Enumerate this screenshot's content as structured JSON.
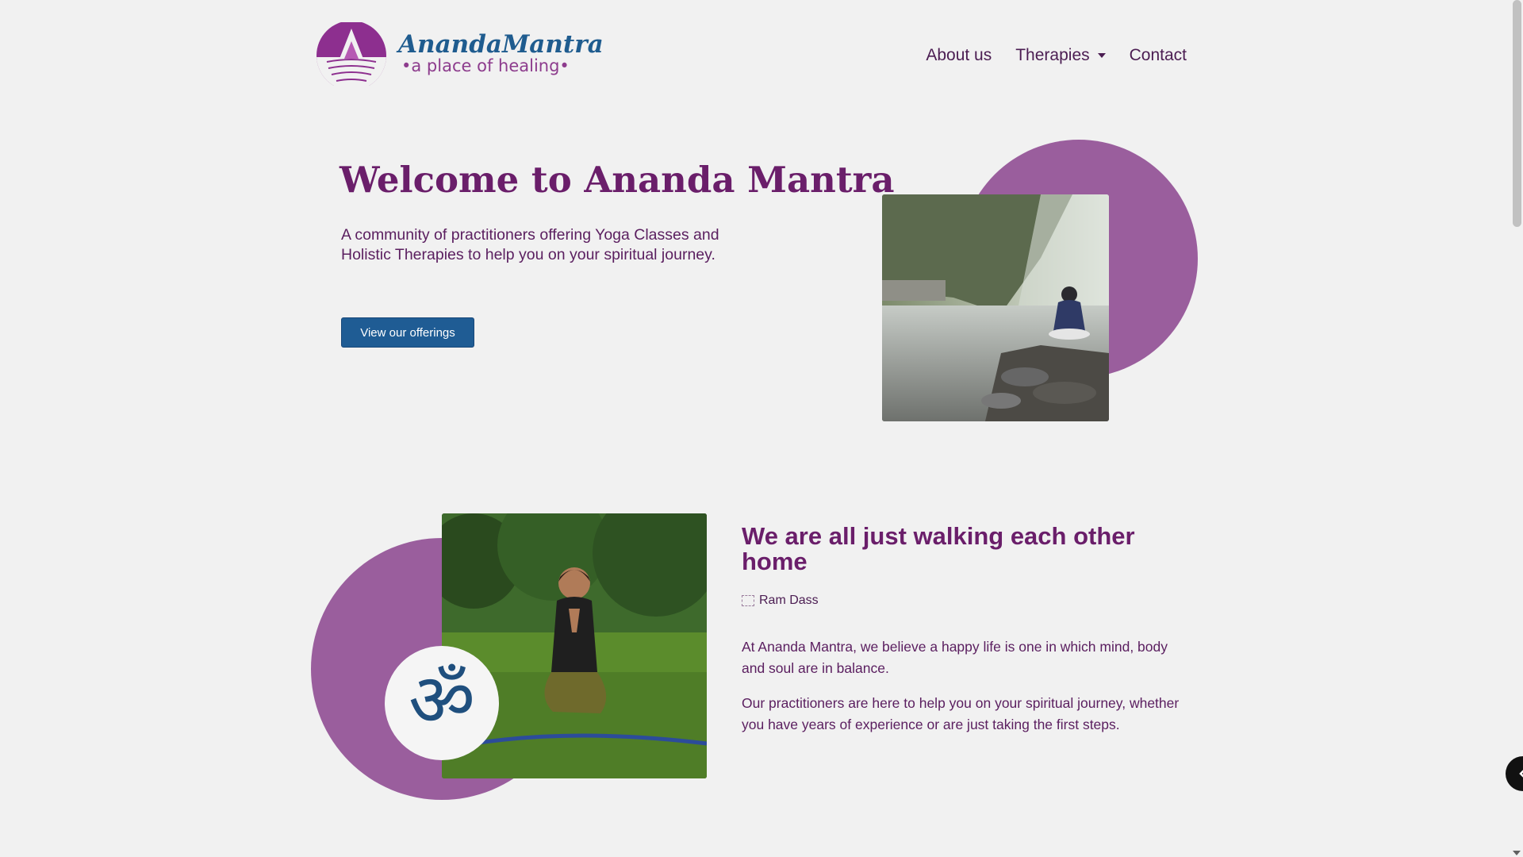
{
  "brand": {
    "name": "AnandaMantra",
    "tagline": "•a place of healing•",
    "primary_color": "#6a1e6a",
    "accent_color": "#9a5e9d",
    "button_color": "#1f5c94"
  },
  "nav": {
    "about": "About us",
    "therapies": "Therapies",
    "contact": "Contact"
  },
  "hero": {
    "title": "Welcome to Ananda Mantra",
    "subtitle": "A community of practitioners offering Yoga Classes and Holistic Therapies to help you on your spiritual journey.",
    "button": "View our offerings"
  },
  "about": {
    "quote": "We are all just walking each other home",
    "author": "Ram Dass",
    "para1": "At Ananda Mantra, we believe a happy life is one in which mind, body and soul are in balance.",
    "para2": "Our practitioners are here to help you on your spiritual journey, whether you have years of experience or are just taking the first steps.",
    "symbol": "ॐ"
  },
  "icons": [
    "lotus-hands-logo-icon",
    "chevron-down-icon",
    "broken-image-icon",
    "om-symbol-icon",
    "chevron-left-icon"
  ]
}
